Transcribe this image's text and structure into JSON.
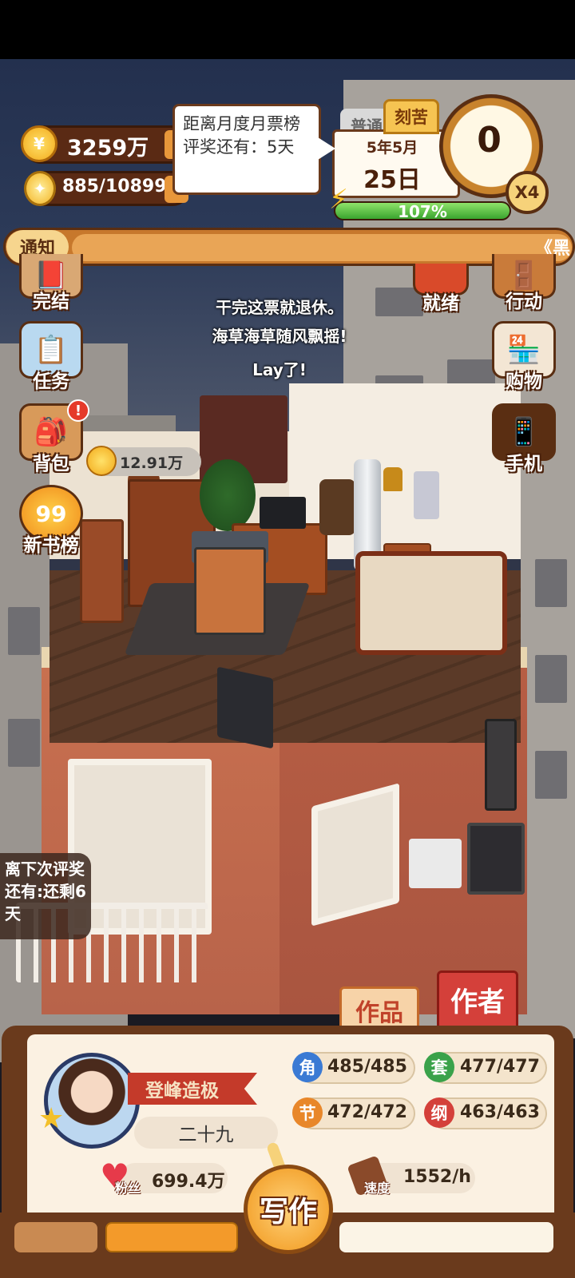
{
  "hud": {
    "money": "3259万",
    "inspiration": "885/10899",
    "tooltip": "距离月度月票榜评奖还有：5天",
    "mode_tab_normal": "普通",
    "mode_tab_hard": "刻苦",
    "date_year_month": "5年5月",
    "date_day": "25日",
    "dial_value": "0",
    "speed_multiplier": "X4",
    "energy_percent": "107%",
    "energy_fraction": 1.0
  },
  "notice": {
    "label": "通知",
    "text": "《黑"
  },
  "left_menu": [
    {
      "label": "完结",
      "icon": "book-icon"
    },
    {
      "label": "任务",
      "icon": "checklist-icon"
    },
    {
      "label": "背包",
      "icon": "backpack-icon",
      "badge": "!"
    },
    {
      "label": "新书榜",
      "icon": "ranking-99-icon",
      "badge_text": "99"
    }
  ],
  "right_menu": [
    {
      "label": "就绪",
      "icon": "ready-icon"
    },
    {
      "label": "行动",
      "icon": "door-icon"
    },
    {
      "label": "购物",
      "icon": "shop-icon",
      "sign": "SHOP"
    },
    {
      "label": "手机",
      "icon": "phone-icon"
    }
  ],
  "speech": [
    "干完这票就退休。",
    "海草海草随风飘摇!",
    "Lay了!"
  ],
  "coin_tag": "12.91万",
  "next_award": "离下次评奖还有:还剩6天",
  "bottom": {
    "tab_works": "作品",
    "tab_author": "作者",
    "author_title": "登峰造极",
    "age": "二十九",
    "stats": [
      {
        "icon": "角",
        "value": "485/485",
        "color": "#3a7ad4"
      },
      {
        "icon": "套",
        "value": "477/477",
        "color": "#3aa24a"
      },
      {
        "icon": "节",
        "value": "472/472",
        "color": "#e8872a"
      },
      {
        "icon": "纲",
        "value": "463/463",
        "color": "#d4403a"
      }
    ],
    "fans_label": "粉丝",
    "fans_value": "699.4万",
    "speed_label": "速度",
    "speed_value": "1552/h",
    "write_button": "写作"
  }
}
